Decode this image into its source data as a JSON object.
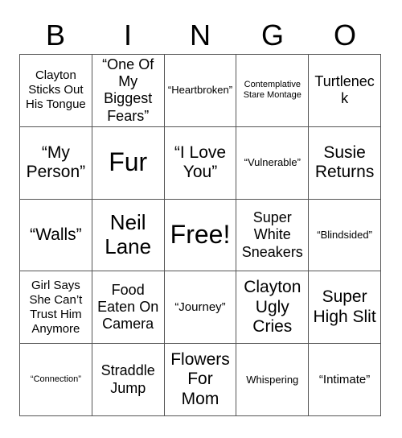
{
  "header": {
    "letters": [
      "B",
      "I",
      "N",
      "G",
      "O"
    ]
  },
  "grid": {
    "columns": 5,
    "rows": 5,
    "border_color": "#555555",
    "cell_background": "#ffffff",
    "text_color": "#000000",
    "cells": [
      {
        "text": "Clayton Sticks Out His Tongue",
        "size": "sz-m"
      },
      {
        "text": "“One Of My Biggest Fears”",
        "size": "sz-l"
      },
      {
        "text": "“Heartbroken”",
        "size": "sz-s"
      },
      {
        "text": "Contemplative Stare Montage",
        "size": "sz-xs"
      },
      {
        "text": "Turtleneck",
        "size": "sz-l"
      },
      {
        "text": "“My Person”",
        "size": "sz-xl"
      },
      {
        "text": "Fur",
        "size": "sz-huge"
      },
      {
        "text": "“I Love You”",
        "size": "sz-xl"
      },
      {
        "text": "“Vulnerable”",
        "size": "sz-s"
      },
      {
        "text": "Susie Returns",
        "size": "sz-xl"
      },
      {
        "text": "“Walls”",
        "size": "sz-xl"
      },
      {
        "text": "Neil Lane",
        "size": "sz-xxl"
      },
      {
        "text": "Free!",
        "size": "sz-huge"
      },
      {
        "text": "Super White Sneakers",
        "size": "sz-l"
      },
      {
        "text": "“Blindsided”",
        "size": "sz-s"
      },
      {
        "text": "Girl Says She Can’t Trust Him Anymore",
        "size": "sz-m"
      },
      {
        "text": "Food Eaten On Camera",
        "size": "sz-l"
      },
      {
        "text": "“Journey”",
        "size": "sz-m"
      },
      {
        "text": "Clayton Ugly Cries",
        "size": "sz-xl"
      },
      {
        "text": "Super High Slit",
        "size": "sz-xl"
      },
      {
        "text": "“Connection”",
        "size": "sz-xs"
      },
      {
        "text": "Straddle Jump",
        "size": "sz-l"
      },
      {
        "text": "Flowers For Mom",
        "size": "sz-xl"
      },
      {
        "text": "Whispering",
        "size": "sz-s"
      },
      {
        "text": "“Intimate”",
        "size": "sz-m"
      }
    ]
  }
}
